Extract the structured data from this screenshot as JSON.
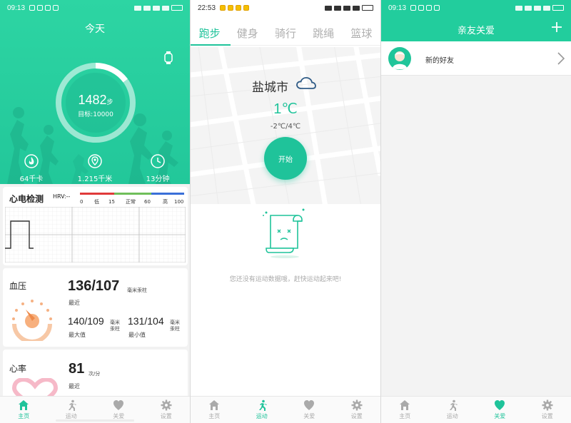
{
  "colors": {
    "accent": "#1fc39a",
    "header": "#22cd9d",
    "bp_orange": "#f39a5f",
    "hr_pink": "#f5a3b8"
  },
  "status": {
    "panel1_time": "09:13",
    "panel2_time": "22:53",
    "panel3_time": "09:13"
  },
  "home": {
    "title": "今天",
    "steps": "1482",
    "steps_unit": "步",
    "goal": "目标:10000",
    "progress": 0.1482,
    "calories": "64千卡",
    "distance": "1.215千米",
    "duration": "13分钟",
    "ecg": {
      "title": "心电检测",
      "hrv": "HRV:--",
      "scale_numbers": [
        "0",
        "15",
        "60",
        "100"
      ],
      "scale_words": [
        "低",
        "正常",
        "高"
      ]
    },
    "bp": {
      "title": "血压",
      "recent_value": "136/107",
      "unit": "毫米汞柱",
      "recent_label": "最近",
      "max_value": "140/109",
      "max_unit": "毫米汞柱",
      "max_label": "最大值",
      "min_value": "131/104",
      "min_unit": "毫米汞柱",
      "min_label": "最小值"
    },
    "hr": {
      "title": "心率",
      "value": "81",
      "unit": "次/分",
      "recent_label": "最近"
    }
  },
  "sport": {
    "tabs": [
      "跑步",
      "健身",
      "骑行",
      "跳绳",
      "篮球"
    ],
    "active_tab": 0,
    "city": "盐城市",
    "weather_icon": "cloud-icon",
    "temperature": "1℃",
    "range": "-2℃/4℃",
    "start_label": "开始",
    "empty_text": "您还没有运动数据哦，赶快运动起来吧!"
  },
  "care": {
    "title": "亲友关爱",
    "friend_label": "新的好友"
  },
  "nav": {
    "items": [
      "主页",
      "运动",
      "关爱",
      "设置"
    ],
    "icons": [
      "home-icon",
      "run-icon",
      "heart-icon",
      "gear-icon"
    ]
  }
}
